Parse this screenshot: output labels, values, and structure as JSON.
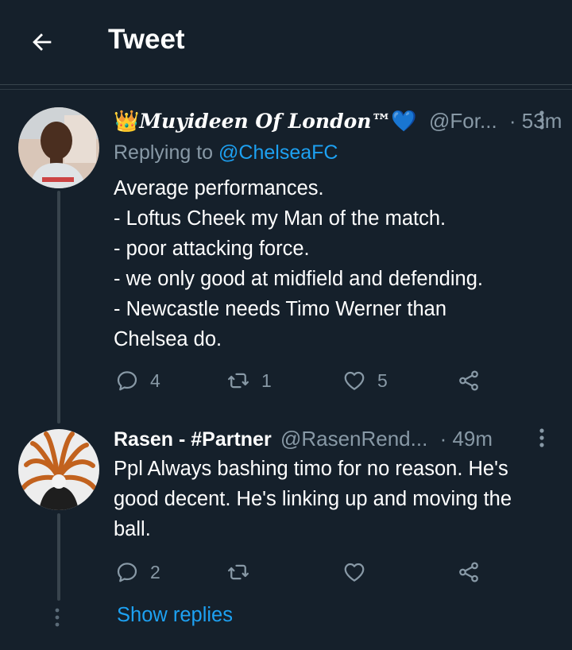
{
  "header": {
    "title": "Tweet",
    "back_icon": "arrow-left-icon"
  },
  "tweets": [
    {
      "display_name_prefix": "👑",
      "display_name": "Muyideen Of London™",
      "badge": "💙",
      "handle": "@For...",
      "time": "· 53m",
      "reply_label": "Replying to",
      "reply_to": "@ChelseaFC",
      "lines": [
        "Average performances.",
        "- Loftus Cheek my Man of the match.",
        "- poor attacking force.",
        "- we only good at midfield and defending.",
        "- Newcastle needs Timo Werner than",
        "Chelsea do."
      ],
      "replies": "4",
      "retweets": "1",
      "likes": "5"
    },
    {
      "display_name": "Rasen - #Partner",
      "handle": "@RasenRend...",
      "time": "· 49m",
      "lines": [
        "Ppl Always bashing timo for no reason. He's",
        "good decent. He's linking up and moving the",
        "ball."
      ],
      "replies": "2",
      "retweets": "",
      "likes": ""
    }
  ],
  "show_replies": "Show replies",
  "colors": {
    "background": "#15202b",
    "accent": "#1da1f2",
    "muted": "#8899a6",
    "divider": "#38444d"
  }
}
